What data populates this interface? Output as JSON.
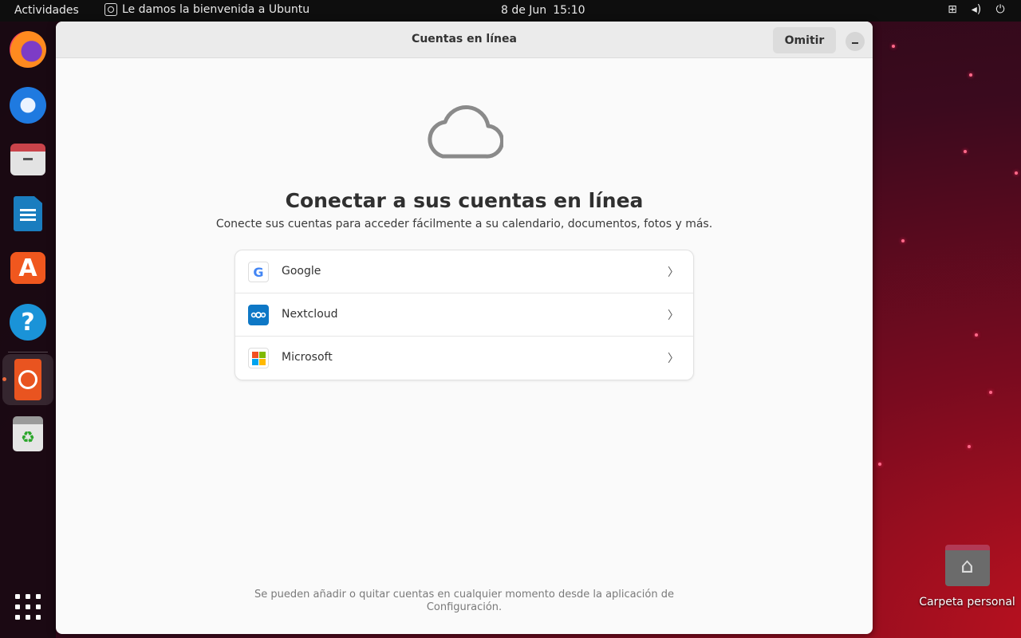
{
  "topbar": {
    "activities": "Actividades",
    "app_title": "Le damos la bienvenida a Ubuntu",
    "date": "8 de Jun",
    "time": "15:10",
    "tray_icons": [
      "network-icon",
      "volume-icon",
      "power-icon"
    ]
  },
  "dock": {
    "items": [
      "Firefox",
      "Thunderbird",
      "Archivos",
      "LibreOffice Writer",
      "App Center",
      "Ayuda",
      "Le damos la bienvenida a Ubuntu",
      "Papelera"
    ],
    "appcenter_glyph": "A",
    "help_glyph": "?",
    "trash_glyph": "♻"
  },
  "window": {
    "title": "Cuentas en línea",
    "skip_label": "Omitir",
    "heading": "Conectar a sus cuentas en línea",
    "subtitle": "Conecte sus cuentas para acceder fácilmente a su calendario, documentos, fotos y más.",
    "providers": [
      {
        "label": "Google",
        "icon": "google-icon"
      },
      {
        "label": "Nextcloud",
        "icon": "nextcloud-icon"
      },
      {
        "label": "Microsoft",
        "icon": "microsoft-icon"
      }
    ],
    "chevron": "〉",
    "google_glyph": "G",
    "footer": "Se pueden añadir o quitar cuentas en cualquier momento desde la aplicación de Configuración."
  },
  "desktop": {
    "home_label": "Carpeta personal"
  },
  "colors": {
    "accent": "#e95420",
    "nextcloud": "#0e78c6",
    "ms_red": "#f25022",
    "ms_green": "#7fba00",
    "ms_blue": "#00a4ef",
    "ms_yellow": "#ffb900"
  }
}
